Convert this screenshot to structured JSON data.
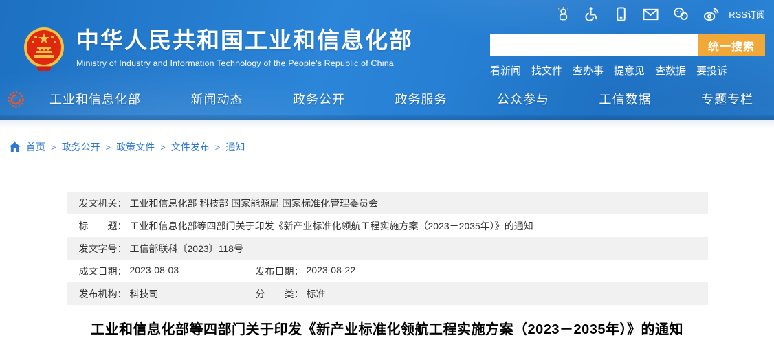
{
  "header": {
    "site_title": "中华人民共和国工业和信息化部",
    "site_subtitle": "Ministry of Industry and Information Technology of the People's Republic of China",
    "rss_label": "RSS订阅",
    "top_icons": [
      "robot-icon",
      "accessibility-icon",
      "mobile-icon",
      "mail-icon",
      "wechat-icon",
      "weibo-icon"
    ],
    "search": {
      "value": "",
      "button_label": "统一搜索"
    },
    "quick_links": [
      "看新闻",
      "找文件",
      "查办事",
      "提意见",
      "查数据",
      "要投诉"
    ],
    "nav_items": [
      "工业和信息化部",
      "新闻动态",
      "政务公开",
      "政务服务",
      "公众参与",
      "工信数据",
      "专题专栏"
    ]
  },
  "breadcrumb": {
    "separator": ">",
    "items": [
      "首页",
      "政务公开",
      "政策文件",
      "文件发布",
      "通知"
    ]
  },
  "doc_meta": {
    "rows": [
      {
        "label": "发文机关：",
        "value": "工业和信息化部 科技部 国家能源局 国家标准化管理委员会"
      },
      {
        "label": "标　　题：",
        "value": "工业和信息化部等四部门关于印发《新产业标准化领航工程实施方案（2023－2035年）》的通知"
      },
      {
        "label": "发文字号：",
        "value": "工信部联科〔2023〕118号"
      },
      {
        "cells": [
          {
            "label": "成文日期：",
            "value": "2023-08-03"
          },
          {
            "label": "发布日期：",
            "value": "2023-08-22"
          }
        ]
      },
      {
        "cells": [
          {
            "label": "发布机构：",
            "value": "科技司"
          },
          {
            "label": "分　　类：",
            "value": "标准"
          }
        ]
      }
    ]
  },
  "article": {
    "title": "工业和信息化部等四部门关于印发《新产业标准化领航工程实施方案（2023－2035年）》的通知"
  },
  "colors": {
    "header_blue": "#2279ce",
    "accent_orange": "#f0a838",
    "link_blue": "#2e7ad2",
    "row_gray": "#f1f1f1",
    "emblem_red": "#de2910",
    "emblem_gold": "#f5c243"
  }
}
